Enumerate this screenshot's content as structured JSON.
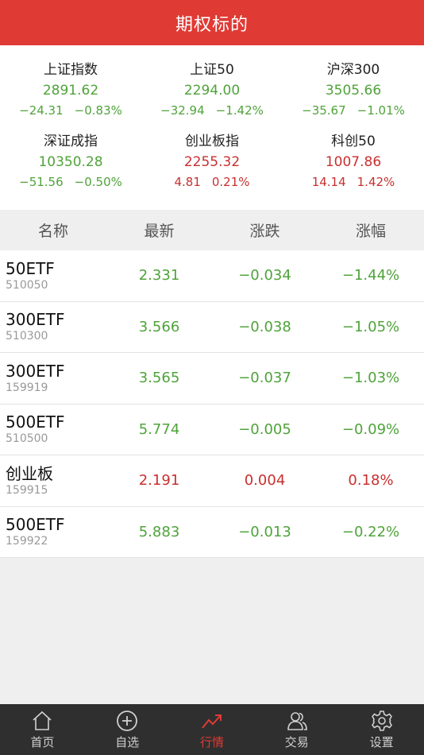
{
  "header": {
    "title": "期权标的"
  },
  "indices": [
    [
      {
        "name": "上证指数",
        "price": "2891.62",
        "change": "−24.31",
        "pct": "−0.83%",
        "dir": "down"
      },
      {
        "name": "上证50",
        "price": "2294.00",
        "change": "−32.94",
        "pct": "−1.42%",
        "dir": "down"
      },
      {
        "name": "沪深300",
        "price": "3505.66",
        "change": "−35.67",
        "pct": "−1.01%",
        "dir": "down"
      }
    ],
    [
      {
        "name": "深证成指",
        "price": "10350.28",
        "change": "−51.56",
        "pct": "−0.50%",
        "dir": "down"
      },
      {
        "name": "创业板指",
        "price": "2255.32",
        "change": "4.81",
        "pct": "0.21%",
        "dir": "up"
      },
      {
        "name": "科创50",
        "price": "1007.86",
        "change": "14.14",
        "pct": "1.42%",
        "dir": "up"
      }
    ]
  ],
  "table": {
    "headers": [
      "名称",
      "最新",
      "涨跌",
      "涨幅"
    ],
    "rows": [
      {
        "name": "50ETF",
        "code": "510050",
        "last": "2.331",
        "change": "−0.034",
        "pct": "−1.44%",
        "dir": "down"
      },
      {
        "name": "300ETF",
        "code": "510300",
        "last": "3.566",
        "change": "−0.038",
        "pct": "−1.05%",
        "dir": "down"
      },
      {
        "name": "300ETF",
        "code": "159919",
        "last": "3.565",
        "change": "−0.037",
        "pct": "−1.03%",
        "dir": "down"
      },
      {
        "name": "500ETF",
        "code": "510500",
        "last": "5.774",
        "change": "−0.005",
        "pct": "−0.09%",
        "dir": "down"
      },
      {
        "name": "创业板",
        "code": "159915",
        "last": "2.191",
        "change": "0.004",
        "pct": "0.18%",
        "dir": "up"
      },
      {
        "name": "500ETF",
        "code": "159922",
        "last": "5.883",
        "change": "−0.013",
        "pct": "−0.22%",
        "dir": "down"
      }
    ]
  },
  "tabbar": [
    {
      "label": "首页",
      "icon": "home-icon",
      "active": false
    },
    {
      "label": "自选",
      "icon": "plus-circle-icon",
      "active": false
    },
    {
      "label": "行情",
      "icon": "trend-icon",
      "active": true
    },
    {
      "label": "交易",
      "icon": "users-icon",
      "active": false
    },
    {
      "label": "设置",
      "icon": "gear-icon",
      "active": false
    }
  ],
  "colors": {
    "accent": "#e03a34",
    "up": "#c8302f",
    "down": "#4fa33a",
    "tabbar_bg": "#2f2f2f"
  }
}
